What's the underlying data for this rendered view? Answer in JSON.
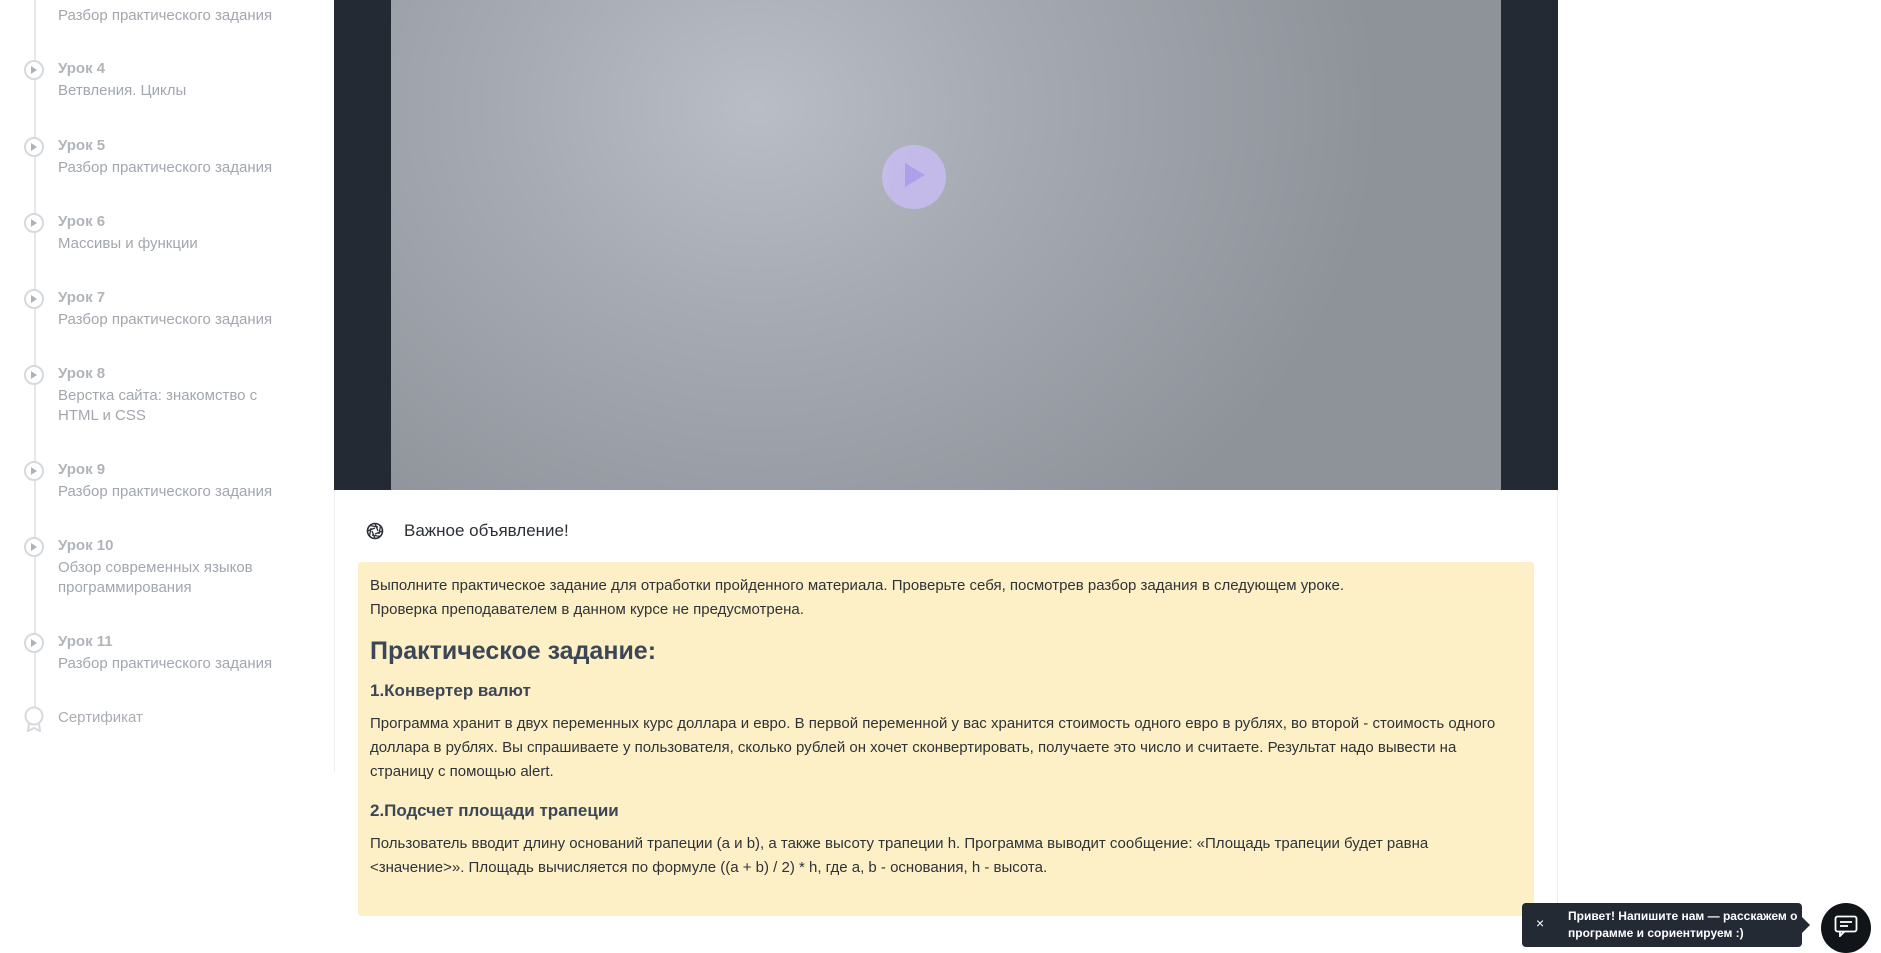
{
  "sidebar": {
    "lessons": [
      {
        "title": "",
        "subtitle": "Разбор практического задания"
      },
      {
        "title": "Урок 4",
        "subtitle": "Ветвления. Циклы"
      },
      {
        "title": "Урок 5",
        "subtitle": "Разбор практического задания"
      },
      {
        "title": "Урок 6",
        "subtitle": "Массивы и функции"
      },
      {
        "title": "Урок 7",
        "subtitle": "Разбор практического задания"
      },
      {
        "title": "Урок 8",
        "subtitle": "Верстка сайта: знакомство с HTML и CSS"
      },
      {
        "title": "Урок 9",
        "subtitle": "Разбор практического задания"
      },
      {
        "title": "Урок 10",
        "subtitle": "Обзор современных языков программирования"
      },
      {
        "title": "Урок 11",
        "subtitle": "Разбор практического задания"
      }
    ],
    "certificate": "Сертификат"
  },
  "video": {
    "play_icon": "play-icon",
    "accent": "#c7bcf0"
  },
  "announcement": {
    "icon": "aperture-icon",
    "title": "Важное объявление!"
  },
  "task": {
    "intro_line1": "Выполните практическое задание для отработки пройденного материала. Проверьте себя, посмотрев разбор задания в следующем уроке.",
    "intro_line2": "Проверка преподавателем в данном курсе не предусмотрена.",
    "heading": "Практическое задание:",
    "items": [
      {
        "title": "1.Конвертер валют",
        "text": "Программа хранит в двух переменных курс доллара и евро. В первой переменной у вас хранится стоимость одного евро в рублях, во второй - стоимость одного доллара в рублях. Вы спрашиваете у пользователя, сколько рублей он хочет сконвертировать, получаете это число и считаете. Результат надо вывести на страницу с помощью alert."
      },
      {
        "title": "2.Подсчет площади трапеции",
        "text": "Пользователь вводит длину оснований трапеции (a и b), а также высоту трапеции h. Программа выводит сообщение: «Площадь трапеции будет равна <значение>». Площадь вычисляется по формуле ((a + b) / 2) * h, где a, b - основания, h - высота."
      }
    ],
    "background": "#fdf0c6"
  },
  "chat": {
    "close_label": "×",
    "message": "Привет! Напишите нам — расскажем о программе и сориентируем :)",
    "icon": "chat-icon"
  }
}
